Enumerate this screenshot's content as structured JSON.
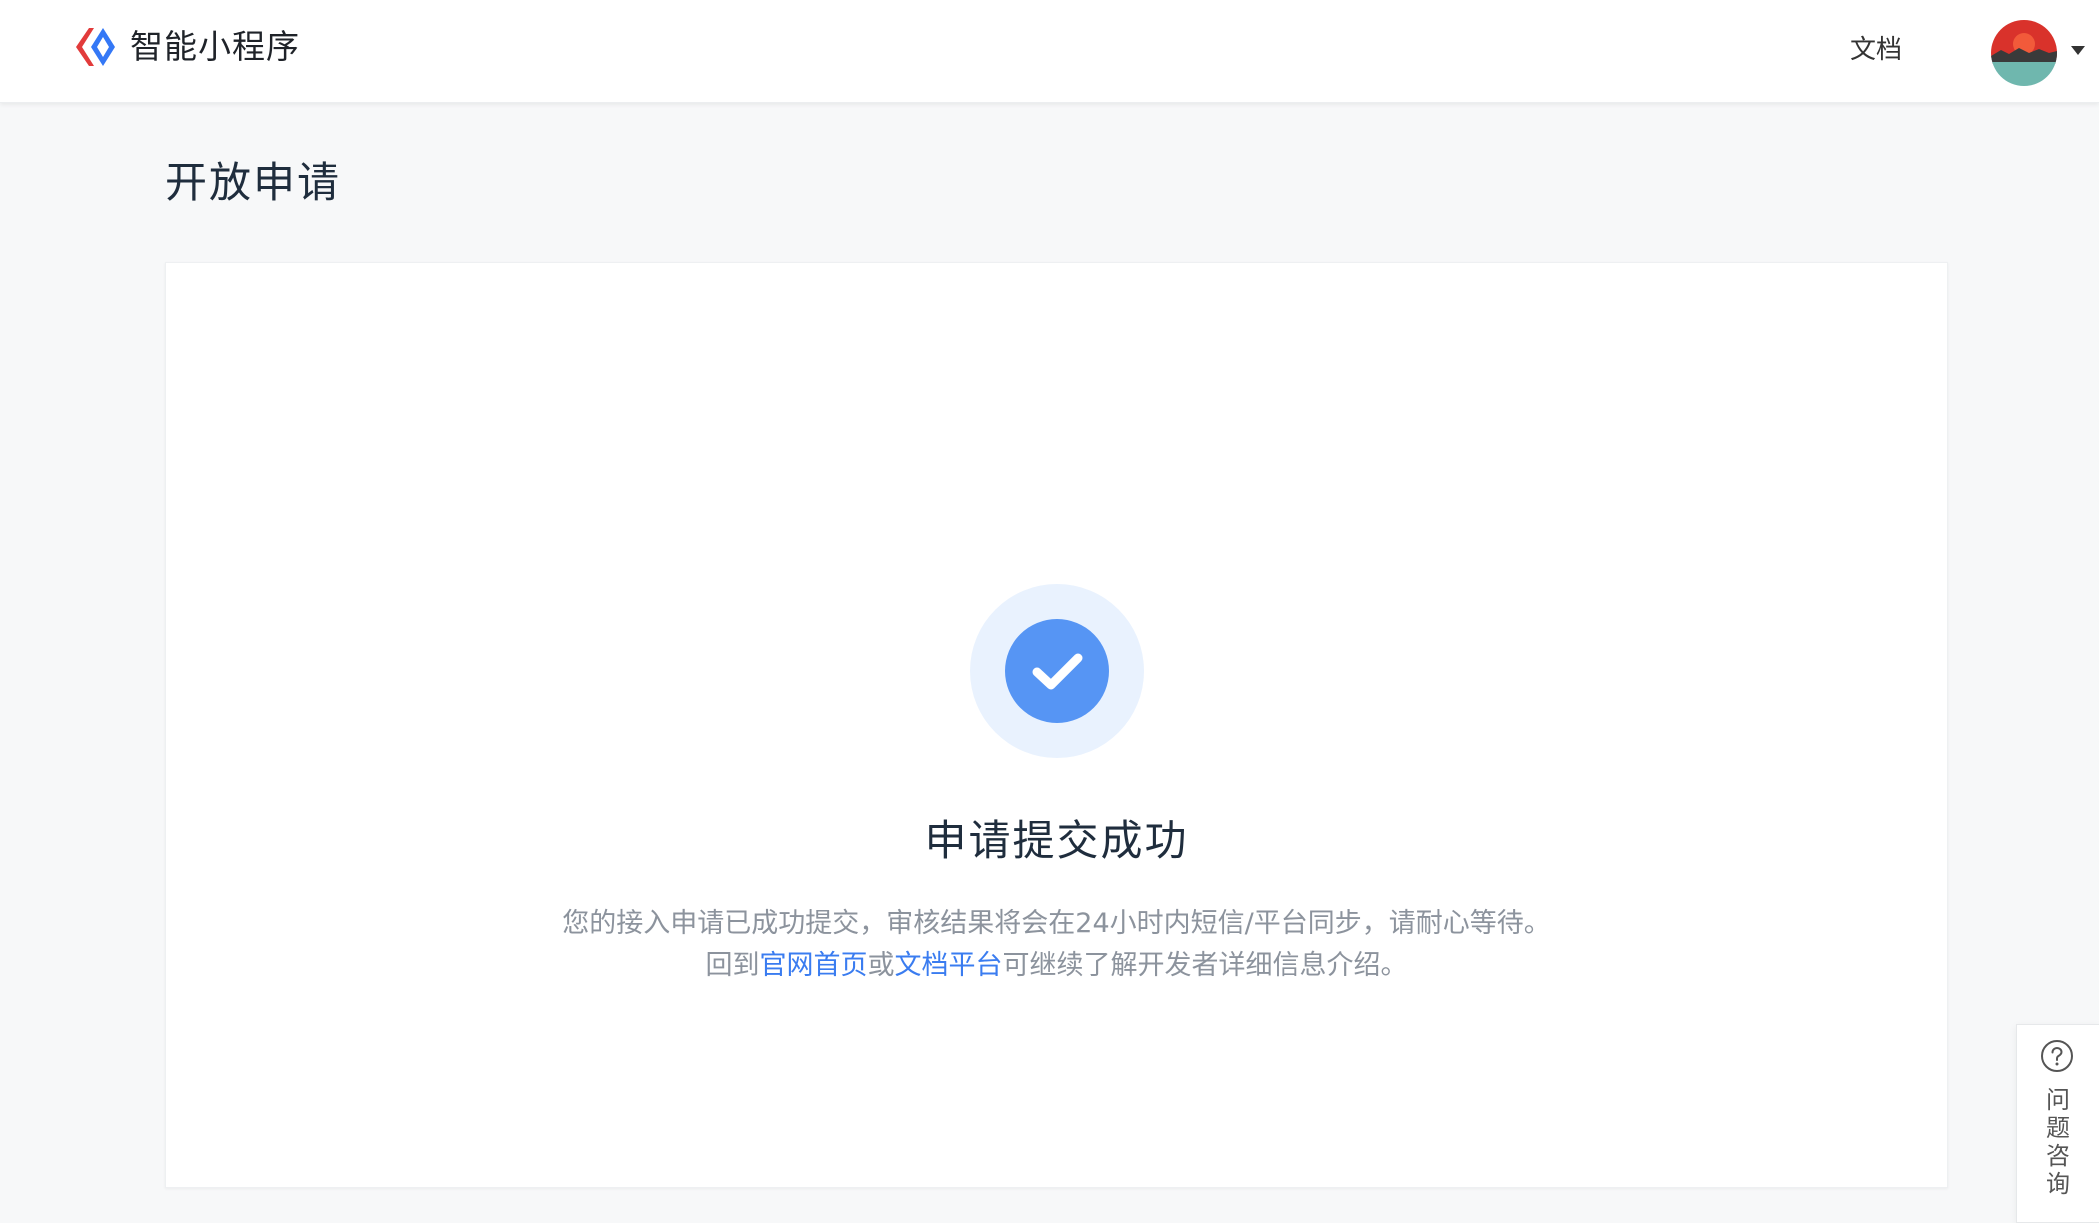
{
  "header": {
    "brand_name": "智能小程序",
    "nav_docs": "文档"
  },
  "page": {
    "title": "开放申请"
  },
  "result": {
    "title": "申请提交成功",
    "desc_line1": "您的接入申请已成功提交，审核结果将会在24小时内短信/平台同步，请耐心等待。",
    "desc_line2_prefix": "回到",
    "link_home": "官网首页",
    "desc_line2_or": "或",
    "link_docs": "文档平台",
    "desc_line2_suffix": "可继续了解开发者详细信息介绍。"
  },
  "help": {
    "label": "问题咨询"
  },
  "icons": {
    "logo": "swan-logo-icon",
    "avatar": "avatar-image",
    "caret": "caret-down-icon",
    "success": "check-circle-icon",
    "help": "question-circle-icon"
  },
  "colors": {
    "primary": "#5695f4",
    "link": "#3a7cf0",
    "halo": "#e9f2fe",
    "logo_red": "#e23b3b",
    "logo_blue": "#3478f6",
    "page_bg": "#f7f8f9"
  }
}
